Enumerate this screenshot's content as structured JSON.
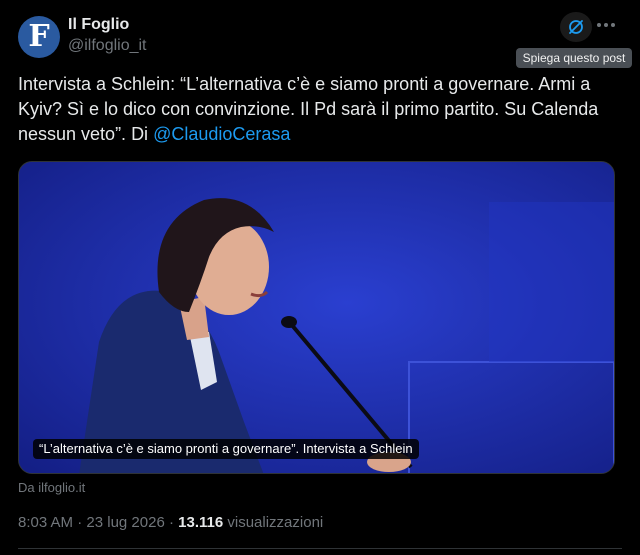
{
  "author": {
    "name": "Il Foglio",
    "handle": "@ilfoglio_it",
    "avatar_letter": "F",
    "avatar_color": "#2a5aa0"
  },
  "actions": {
    "grok_icon": "grok-explain-icon",
    "more_icon": "more-horizontal-icon",
    "tooltip": "Spiega questo post"
  },
  "post": {
    "text": "Intervista a Schlein: “L’alternativa c’è e siamo pronti a governare. Armi a Kyiv? Sì e lo dico con convinzione. Il Pd sarà il primo partito. Su Calenda nessun veto”. Di ",
    "mention": "@ClaudioCerasa"
  },
  "card": {
    "caption": "“L’alternativa c’è e siamo pronti a governare”. Intervista a Schlein",
    "source": "Da ilfoglio.it",
    "background_color": "#1c2d9a"
  },
  "meta": {
    "time": "8:03 AM",
    "separator": " · ",
    "date": "23 lug 2026",
    "views_count": "13.116",
    "views_label": " visualizzazioni"
  },
  "colors": {
    "background": "#000000",
    "text_primary": "#e7e9ea",
    "text_secondary": "#71767b",
    "link": "#1d9bf0"
  }
}
